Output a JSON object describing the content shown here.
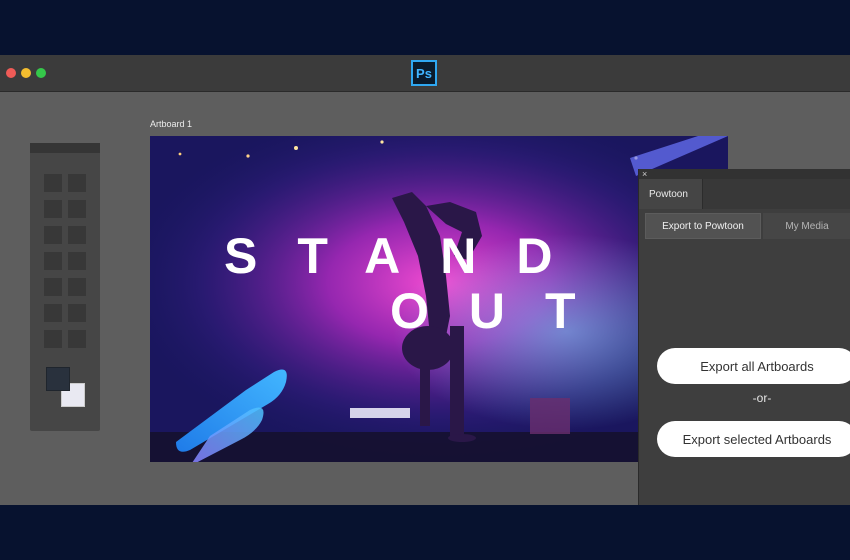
{
  "app": {
    "logo_text": "Ps",
    "window_controls": [
      "close",
      "minimize",
      "zoom"
    ]
  },
  "artboard": {
    "label": "Artboard 1",
    "headline_line1": "STAND",
    "headline_line2": "OUT"
  },
  "panel": {
    "tab_label": "Powtoon",
    "close_glyph": "×",
    "subtabs": [
      {
        "label": "Export to Powtoon",
        "active": true
      },
      {
        "label": "My Media",
        "active": false
      }
    ],
    "export_all_label": "Export all Artboards",
    "or_label": "-or-",
    "export_selected_label": "Export selected Artboards"
  },
  "colors": {
    "outer_background": "#07122f",
    "workspace": "#5e5e5e",
    "panel": "#3e3e3e",
    "accent_blue": "#2fa8f2",
    "stage_magenta": "#e52fc8"
  }
}
